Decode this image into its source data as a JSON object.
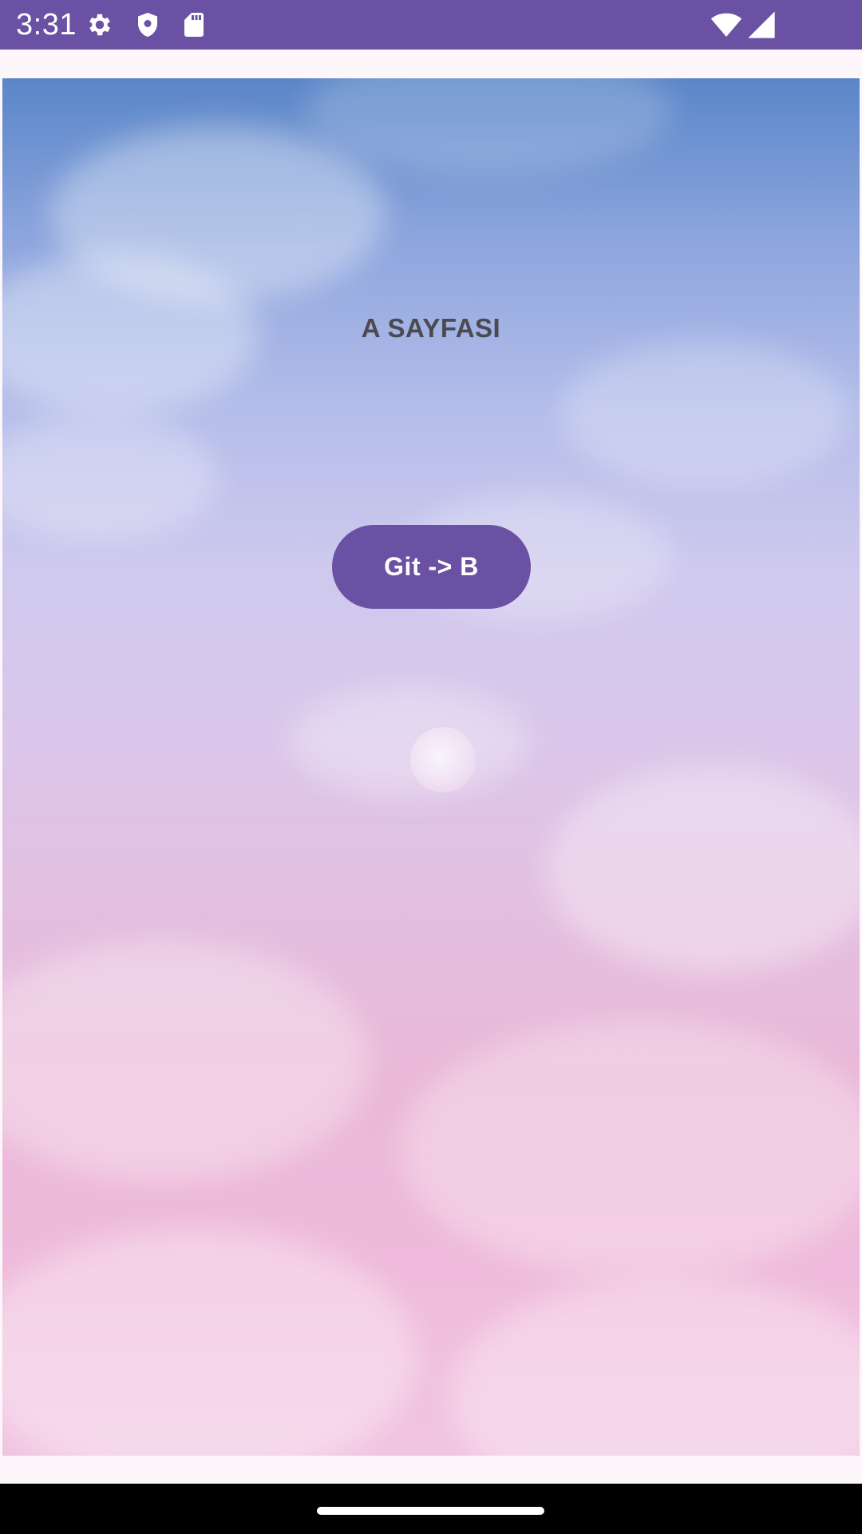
{
  "status_bar": {
    "time": "3:31",
    "left_icons": [
      "gear-icon",
      "shield-icon",
      "sd-card-icon"
    ],
    "right_icons": [
      "wifi-icon",
      "signal-icon"
    ],
    "color": "#6a51a4"
  },
  "page": {
    "title": "A SAYFASI",
    "button_label": "Git -> B",
    "accent_color": "#6a51a4",
    "background": "sky-clouds-moon-image"
  },
  "nav_bar": {
    "handle": "home-handle"
  }
}
